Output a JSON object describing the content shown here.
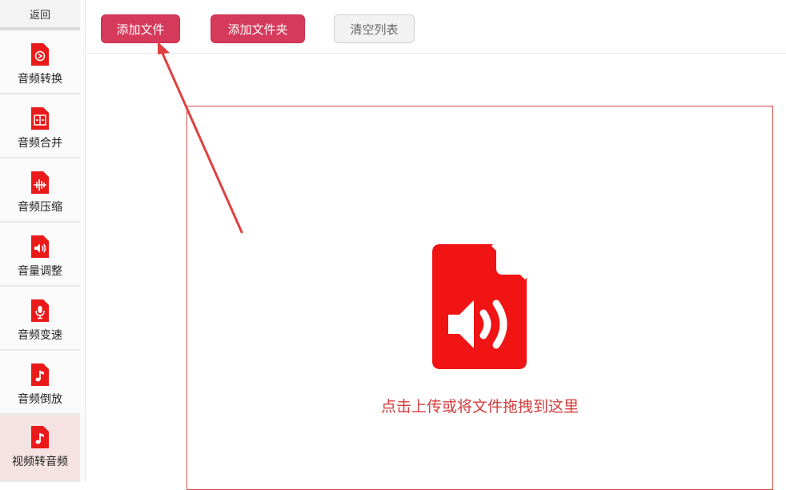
{
  "sidebar": {
    "back_label": "返回",
    "items": [
      {
        "label": "音频转换",
        "icon": "audio-convert-icon"
      },
      {
        "label": "音频合并",
        "icon": "audio-merge-icon"
      },
      {
        "label": "音频压缩",
        "icon": "audio-compress-icon"
      },
      {
        "label": "音量调整",
        "icon": "volume-adjust-icon"
      },
      {
        "label": "音频变速",
        "icon": "audio-speed-icon"
      },
      {
        "label": "音频倒放",
        "icon": "audio-reverse-icon"
      },
      {
        "label": "视频转音频",
        "icon": "video-to-audio-icon"
      }
    ],
    "active_index": 6
  },
  "toolbar": {
    "add_file_label": "添加文件",
    "add_folder_label": "添加文件夹",
    "clear_list_label": "清空列表"
  },
  "dropzone": {
    "icon": "audio-file-icon",
    "hint": "点击上传或将文件拖拽到这里"
  },
  "colors": {
    "accent": "#d63a5b",
    "icon_red": "#f01414",
    "hint_red": "#d43c3c",
    "active_bg": "#f5e3e3"
  }
}
